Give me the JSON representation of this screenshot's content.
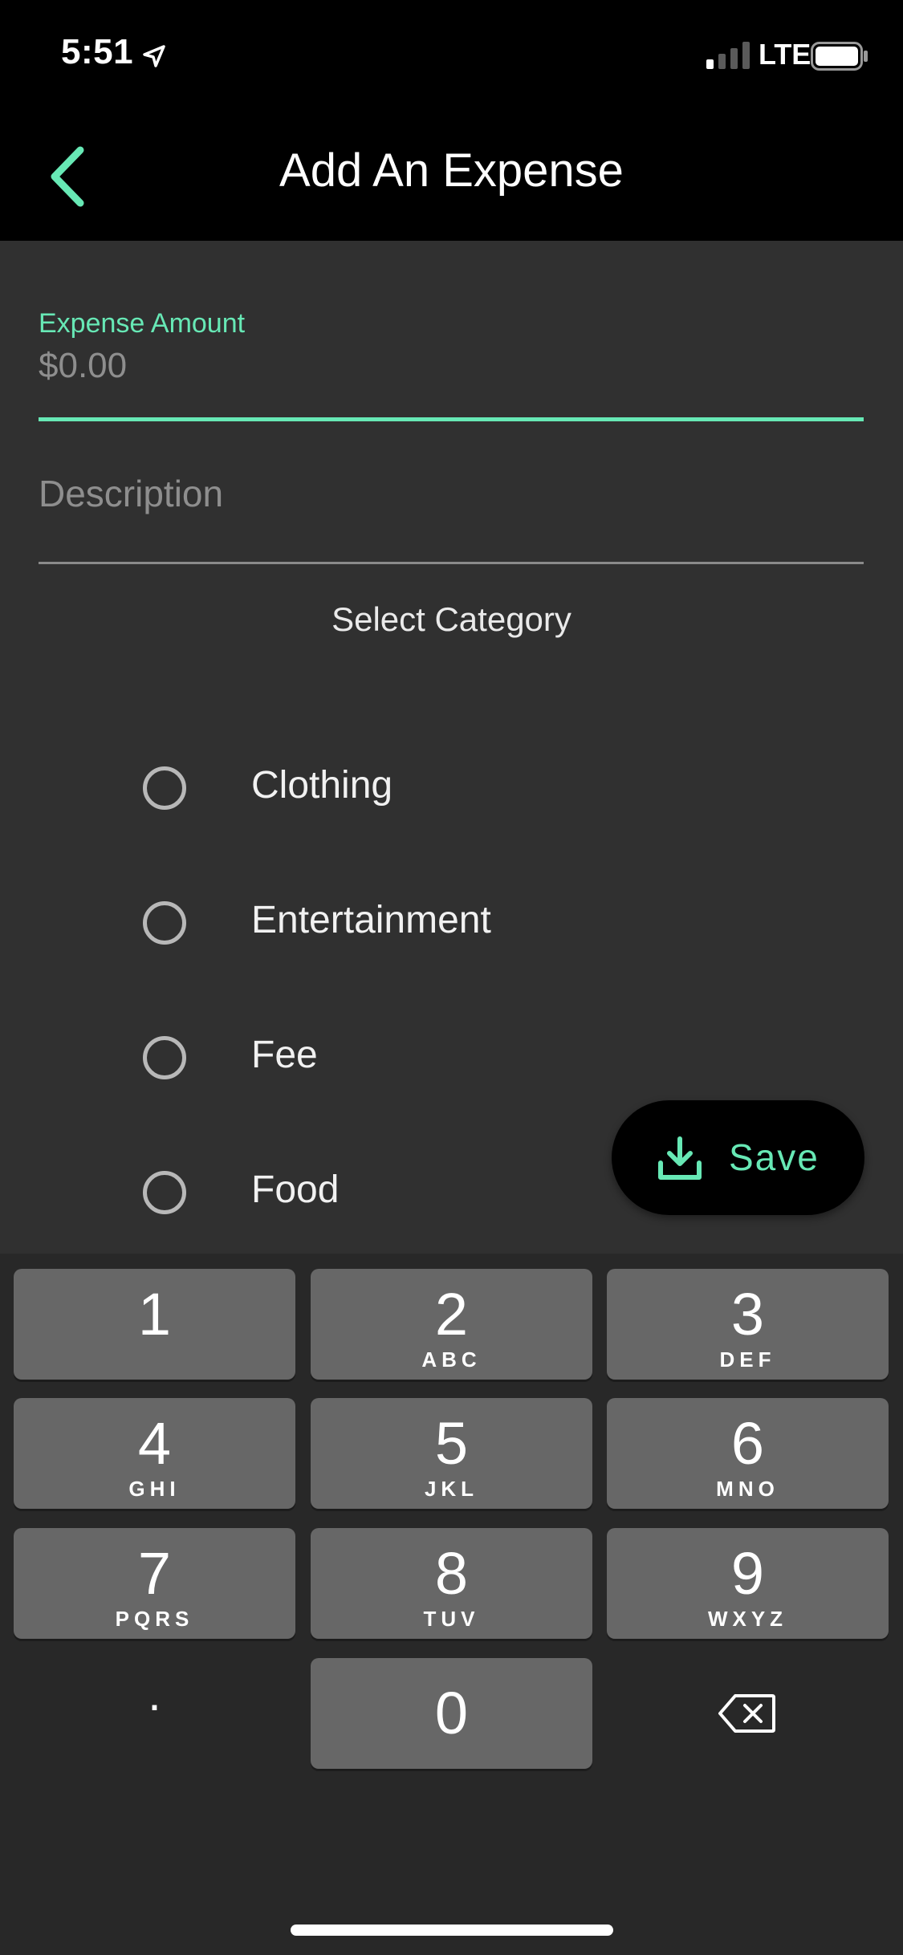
{
  "status_bar": {
    "time": "5:51",
    "network": "LTE"
  },
  "nav": {
    "title": "Add An Expense",
    "back_icon": "chevron-left-icon"
  },
  "form": {
    "amount_label": "Expense Amount",
    "amount_placeholder": "$0.00",
    "description_placeholder": "Description",
    "category_title": "Select Category"
  },
  "categories": [
    {
      "label": "Clothing",
      "selected": false
    },
    {
      "label": "Entertainment",
      "selected": false
    },
    {
      "label": "Fee",
      "selected": false
    },
    {
      "label": "Food",
      "selected": false
    }
  ],
  "save_button": {
    "label": "Save",
    "icon": "download-icon"
  },
  "keypad": {
    "keys": [
      {
        "num": "1",
        "letters": ""
      },
      {
        "num": "2",
        "letters": "ABC"
      },
      {
        "num": "3",
        "letters": "DEF"
      },
      {
        "num": "4",
        "letters": "GHI"
      },
      {
        "num": "5",
        "letters": "JKL"
      },
      {
        "num": "6",
        "letters": "MNO"
      },
      {
        "num": "7",
        "letters": "PQRS"
      },
      {
        "num": "8",
        "letters": "TUV"
      },
      {
        "num": "9",
        "letters": "WXYZ"
      },
      {
        "num": "0",
        "letters": ""
      }
    ],
    "decimal": ".",
    "delete_icon": "backspace-icon"
  },
  "colors": {
    "accent": "#67e8b5",
    "background": "#303030",
    "keyboard": "#282828",
    "key": "#676767"
  }
}
